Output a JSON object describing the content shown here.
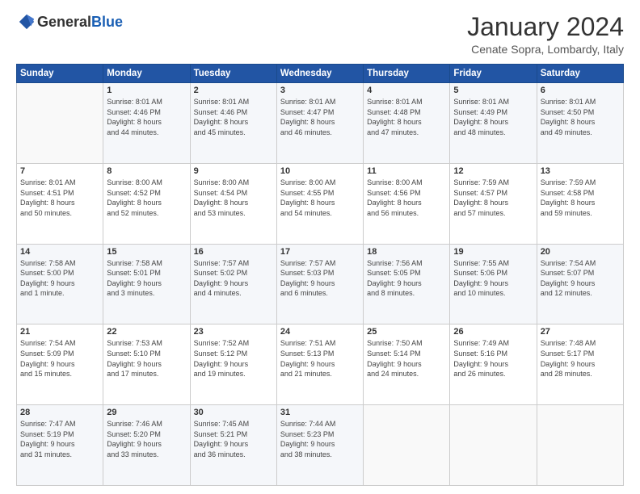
{
  "header": {
    "logo": {
      "general": "General",
      "blue": "Blue"
    },
    "title": "January 2024",
    "location": "Cenate Sopra, Lombardy, Italy"
  },
  "days_of_week": [
    "Sunday",
    "Monday",
    "Tuesday",
    "Wednesday",
    "Thursday",
    "Friday",
    "Saturday"
  ],
  "weeks": [
    [
      {
        "day": "",
        "info": ""
      },
      {
        "day": "1",
        "info": "Sunrise: 8:01 AM\nSunset: 4:46 PM\nDaylight: 8 hours\nand 44 minutes."
      },
      {
        "day": "2",
        "info": "Sunrise: 8:01 AM\nSunset: 4:46 PM\nDaylight: 8 hours\nand 45 minutes."
      },
      {
        "day": "3",
        "info": "Sunrise: 8:01 AM\nSunset: 4:47 PM\nDaylight: 8 hours\nand 46 minutes."
      },
      {
        "day": "4",
        "info": "Sunrise: 8:01 AM\nSunset: 4:48 PM\nDaylight: 8 hours\nand 47 minutes."
      },
      {
        "day": "5",
        "info": "Sunrise: 8:01 AM\nSunset: 4:49 PM\nDaylight: 8 hours\nand 48 minutes."
      },
      {
        "day": "6",
        "info": "Sunrise: 8:01 AM\nSunset: 4:50 PM\nDaylight: 8 hours\nand 49 minutes."
      }
    ],
    [
      {
        "day": "7",
        "info": "Sunrise: 8:01 AM\nSunset: 4:51 PM\nDaylight: 8 hours\nand 50 minutes."
      },
      {
        "day": "8",
        "info": "Sunrise: 8:00 AM\nSunset: 4:52 PM\nDaylight: 8 hours\nand 52 minutes."
      },
      {
        "day": "9",
        "info": "Sunrise: 8:00 AM\nSunset: 4:54 PM\nDaylight: 8 hours\nand 53 minutes."
      },
      {
        "day": "10",
        "info": "Sunrise: 8:00 AM\nSunset: 4:55 PM\nDaylight: 8 hours\nand 54 minutes."
      },
      {
        "day": "11",
        "info": "Sunrise: 8:00 AM\nSunset: 4:56 PM\nDaylight: 8 hours\nand 56 minutes."
      },
      {
        "day": "12",
        "info": "Sunrise: 7:59 AM\nSunset: 4:57 PM\nDaylight: 8 hours\nand 57 minutes."
      },
      {
        "day": "13",
        "info": "Sunrise: 7:59 AM\nSunset: 4:58 PM\nDaylight: 8 hours\nand 59 minutes."
      }
    ],
    [
      {
        "day": "14",
        "info": "Sunrise: 7:58 AM\nSunset: 5:00 PM\nDaylight: 9 hours\nand 1 minute."
      },
      {
        "day": "15",
        "info": "Sunrise: 7:58 AM\nSunset: 5:01 PM\nDaylight: 9 hours\nand 3 minutes."
      },
      {
        "day": "16",
        "info": "Sunrise: 7:57 AM\nSunset: 5:02 PM\nDaylight: 9 hours\nand 4 minutes."
      },
      {
        "day": "17",
        "info": "Sunrise: 7:57 AM\nSunset: 5:03 PM\nDaylight: 9 hours\nand 6 minutes."
      },
      {
        "day": "18",
        "info": "Sunrise: 7:56 AM\nSunset: 5:05 PM\nDaylight: 9 hours\nand 8 minutes."
      },
      {
        "day": "19",
        "info": "Sunrise: 7:55 AM\nSunset: 5:06 PM\nDaylight: 9 hours\nand 10 minutes."
      },
      {
        "day": "20",
        "info": "Sunrise: 7:54 AM\nSunset: 5:07 PM\nDaylight: 9 hours\nand 12 minutes."
      }
    ],
    [
      {
        "day": "21",
        "info": "Sunrise: 7:54 AM\nSunset: 5:09 PM\nDaylight: 9 hours\nand 15 minutes."
      },
      {
        "day": "22",
        "info": "Sunrise: 7:53 AM\nSunset: 5:10 PM\nDaylight: 9 hours\nand 17 minutes."
      },
      {
        "day": "23",
        "info": "Sunrise: 7:52 AM\nSunset: 5:12 PM\nDaylight: 9 hours\nand 19 minutes."
      },
      {
        "day": "24",
        "info": "Sunrise: 7:51 AM\nSunset: 5:13 PM\nDaylight: 9 hours\nand 21 minutes."
      },
      {
        "day": "25",
        "info": "Sunrise: 7:50 AM\nSunset: 5:14 PM\nDaylight: 9 hours\nand 24 minutes."
      },
      {
        "day": "26",
        "info": "Sunrise: 7:49 AM\nSunset: 5:16 PM\nDaylight: 9 hours\nand 26 minutes."
      },
      {
        "day": "27",
        "info": "Sunrise: 7:48 AM\nSunset: 5:17 PM\nDaylight: 9 hours\nand 28 minutes."
      }
    ],
    [
      {
        "day": "28",
        "info": "Sunrise: 7:47 AM\nSunset: 5:19 PM\nDaylight: 9 hours\nand 31 minutes."
      },
      {
        "day": "29",
        "info": "Sunrise: 7:46 AM\nSunset: 5:20 PM\nDaylight: 9 hours\nand 33 minutes."
      },
      {
        "day": "30",
        "info": "Sunrise: 7:45 AM\nSunset: 5:21 PM\nDaylight: 9 hours\nand 36 minutes."
      },
      {
        "day": "31",
        "info": "Sunrise: 7:44 AM\nSunset: 5:23 PM\nDaylight: 9 hours\nand 38 minutes."
      },
      {
        "day": "",
        "info": ""
      },
      {
        "day": "",
        "info": ""
      },
      {
        "day": "",
        "info": ""
      }
    ]
  ]
}
